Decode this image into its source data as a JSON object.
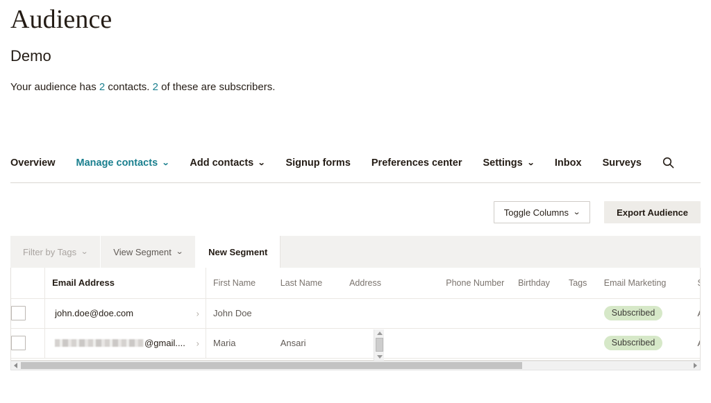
{
  "header": {
    "page_title": "Audience",
    "audience_name": "Demo",
    "summary_prefix": "Your audience has ",
    "contacts_count": "2",
    "summary_middle": " contacts. ",
    "subscribers_count": "2",
    "summary_suffix": " of these are subscribers.",
    "accent_color": "#1a7f8e"
  },
  "nav": {
    "items": [
      {
        "label": "Overview",
        "has_caret": false,
        "active": false
      },
      {
        "label": "Manage contacts",
        "has_caret": true,
        "active": true
      },
      {
        "label": "Add contacts",
        "has_caret": true,
        "active": false
      },
      {
        "label": "Signup forms",
        "has_caret": false,
        "active": false
      },
      {
        "label": "Preferences center",
        "has_caret": false,
        "active": false
      },
      {
        "label": "Settings",
        "has_caret": true,
        "active": false
      },
      {
        "label": "Inbox",
        "has_caret": false,
        "active": false
      },
      {
        "label": "Surveys",
        "has_caret": false,
        "active": false
      }
    ],
    "search_icon": "search-icon",
    "caret_glyph": "⌄"
  },
  "toolbar": {
    "toggle_columns_label": "Toggle Columns",
    "toggle_columns_caret": "⌄",
    "export_audience_label": "Export Audience"
  },
  "segment_bar": {
    "tabs": [
      {
        "label": "Filter by Tags",
        "has_caret": true,
        "state": "disabled"
      },
      {
        "label": "View Segment",
        "has_caret": true,
        "state": "normal"
      },
      {
        "label": "New Segment",
        "has_caret": false,
        "state": "active"
      }
    ],
    "caret_glyph": "⌄"
  },
  "table": {
    "columns": [
      "Email Address",
      "First Name",
      "Last Name",
      "Address",
      "Phone Number",
      "Birthday",
      "Tags",
      "Email Marketing",
      "Source"
    ],
    "chevron_glyph": "›",
    "rows": [
      {
        "email": "john.doe@doe.com",
        "email_redacted": false,
        "first_name": "John Doe",
        "last_name": "",
        "address": "",
        "phone": "",
        "birthday": "",
        "tags": "",
        "email_marketing": "Subscribed",
        "source": "Admin Add"
      },
      {
        "email": "@gmail....",
        "email_redacted": true,
        "first_name": "Maria",
        "last_name": "Ansari",
        "address": "",
        "phone": "",
        "birthday": "",
        "tags": "",
        "email_marketing": "Subscribed",
        "source": "Admin Add"
      }
    ],
    "badge_color": "#d6e8c8"
  }
}
